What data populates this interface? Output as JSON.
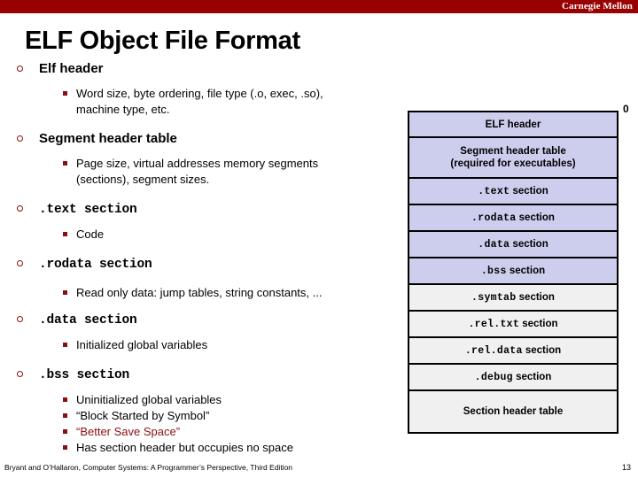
{
  "header": {
    "brand": "Carnegie Mellon",
    "bar_color": "#990000"
  },
  "title": "ELF Object File Format",
  "bullets": [
    {
      "label": "Elf header",
      "mono": false,
      "children": [
        "Word size, byte ordering, file type (.o, exec, .so),",
        "machine type, etc."
      ]
    },
    {
      "label": "Segment header table",
      "mono": false,
      "children": [
        "Page size, virtual addresses memory segments",
        "(sections), segment sizes."
      ]
    },
    {
      "label": ".text section",
      "mono": true,
      "children": [
        "Code"
      ]
    },
    {
      "label": ".rodata section",
      "mono": true,
      "children": [
        "Read only data: jump tables, string constants, ..."
      ]
    },
    {
      "label": ".data section",
      "mono": true,
      "children": [
        "Initialized global variables"
      ]
    },
    {
      "label": ".bss section",
      "mono": true,
      "children": [
        "Uninitialized global variables",
        "“Block Started by Symbol”",
        "“Better Save Space”",
        "Has section header but occupies no space"
      ]
    }
  ],
  "diagram": {
    "offset_label": "0",
    "boxes": [
      {
        "mono_part": "",
        "text": "ELF header",
        "line2": "",
        "fill": "lavender"
      },
      {
        "mono_part": "",
        "text": "Segment header table",
        "line2": "(required for executables)",
        "fill": "lavender"
      },
      {
        "mono_part": ".text",
        "text": " section",
        "line2": "",
        "fill": "lavender"
      },
      {
        "mono_part": ".rodata",
        "text": " section",
        "line2": "",
        "fill": "lavender"
      },
      {
        "mono_part": ".data",
        "text": " section",
        "line2": "",
        "fill": "lavender"
      },
      {
        "mono_part": ".bss",
        "text": " section",
        "line2": "",
        "fill": "lavender"
      },
      {
        "mono_part": ".symtab",
        "text": " section",
        "line2": "",
        "fill": "gray"
      },
      {
        "mono_part": ".rel.txt",
        "text": " section",
        "line2": "",
        "fill": "gray"
      },
      {
        "mono_part": ".rel.data",
        "text": " section",
        "line2": "",
        "fill": "gray"
      },
      {
        "mono_part": ".debug",
        "text": " section",
        "line2": "",
        "fill": "gray"
      },
      {
        "mono_part": "",
        "text": "Section header table",
        "line2": "",
        "fill": "gray"
      }
    ],
    "colors": {
      "lavender": "#cdcdee",
      "gray": "#f0f0f0",
      "border": "#000000"
    }
  },
  "footer": {
    "citation": "Bryant and O’Hallaron, Computer Systems: A Programmer’s Perspective, Third Edition",
    "page": "13"
  },
  "accent": {
    "bullet_red": "#8a1010",
    "band_red": "#990000"
  }
}
